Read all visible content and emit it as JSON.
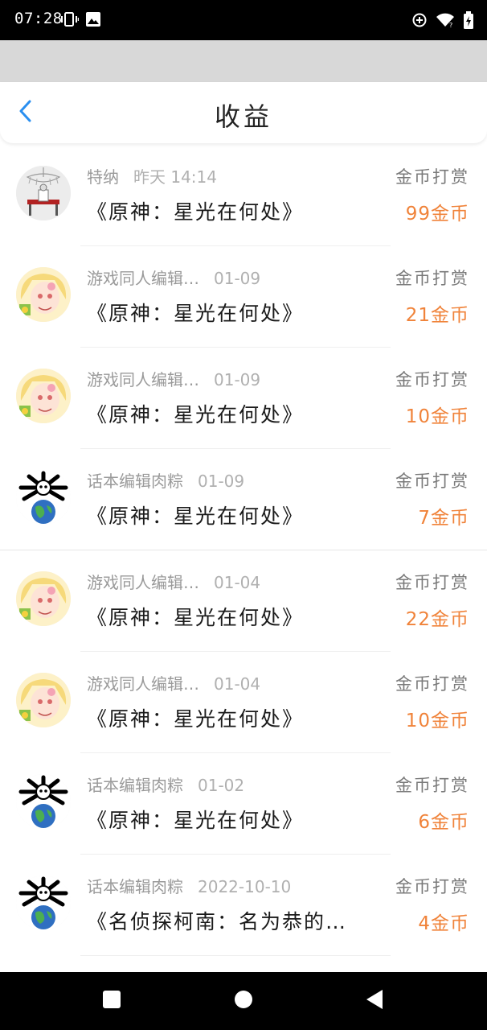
{
  "status_bar": {
    "time": "07:28",
    "left_icons": [
      "vibrate-icon",
      "image-icon"
    ],
    "right_icons": [
      "data-saver-icon",
      "wifi-icon",
      "battery-icon"
    ]
  },
  "header": {
    "title": "收益",
    "back_icon": "chevron-left-icon"
  },
  "colors": {
    "accent_blue": "#2a8ff0",
    "amount_orange": "#f0833a"
  },
  "income_items": [
    {
      "user": "特纳",
      "time": "昨天 14:14",
      "work": "《原神：星光在何处》",
      "type": "金币打赏",
      "amount": "99金币",
      "avatar": "avatar-chandelier"
    },
    {
      "user": "游戏同人编辑…",
      "time": "01-09",
      "work": "《原神：星光在何处》",
      "type": "金币打赏",
      "amount": "21金币",
      "avatar": "avatar-anime-girl"
    },
    {
      "user": "游戏同人编辑…",
      "time": "01-09",
      "work": "《原神：星光在何处》",
      "type": "金币打赏",
      "amount": "10金币",
      "avatar": "avatar-anime-girl"
    },
    {
      "user": "话本编辑肉粽",
      "time": "01-09",
      "work": "《原神：星光在何处》",
      "type": "金币打赏",
      "amount": "7金币",
      "avatar": "avatar-earth-panda"
    },
    {
      "user": "游戏同人编辑…",
      "time": "01-04",
      "work": "《原神：星光在何处》",
      "type": "金币打赏",
      "amount": "22金币",
      "avatar": "avatar-anime-girl"
    },
    {
      "user": "游戏同人编辑…",
      "time": "01-04",
      "work": "《原神：星光在何处》",
      "type": "金币打赏",
      "amount": "10金币",
      "avatar": "avatar-anime-girl"
    },
    {
      "user": "话本编辑肉粽",
      "time": "01-02",
      "work": "《原神：星光在何处》",
      "type": "金币打赏",
      "amount": "6金币",
      "avatar": "avatar-earth-panda"
    },
    {
      "user": "话本编辑肉粽",
      "time": "2022-10-10",
      "work": "《名侦探柯南：名为恭的…",
      "type": "金币打赏",
      "amount": "4金币",
      "avatar": "avatar-earth-panda"
    }
  ],
  "nav_bar": {
    "buttons": [
      "recents-icon",
      "home-icon",
      "back-triangle-icon"
    ]
  }
}
